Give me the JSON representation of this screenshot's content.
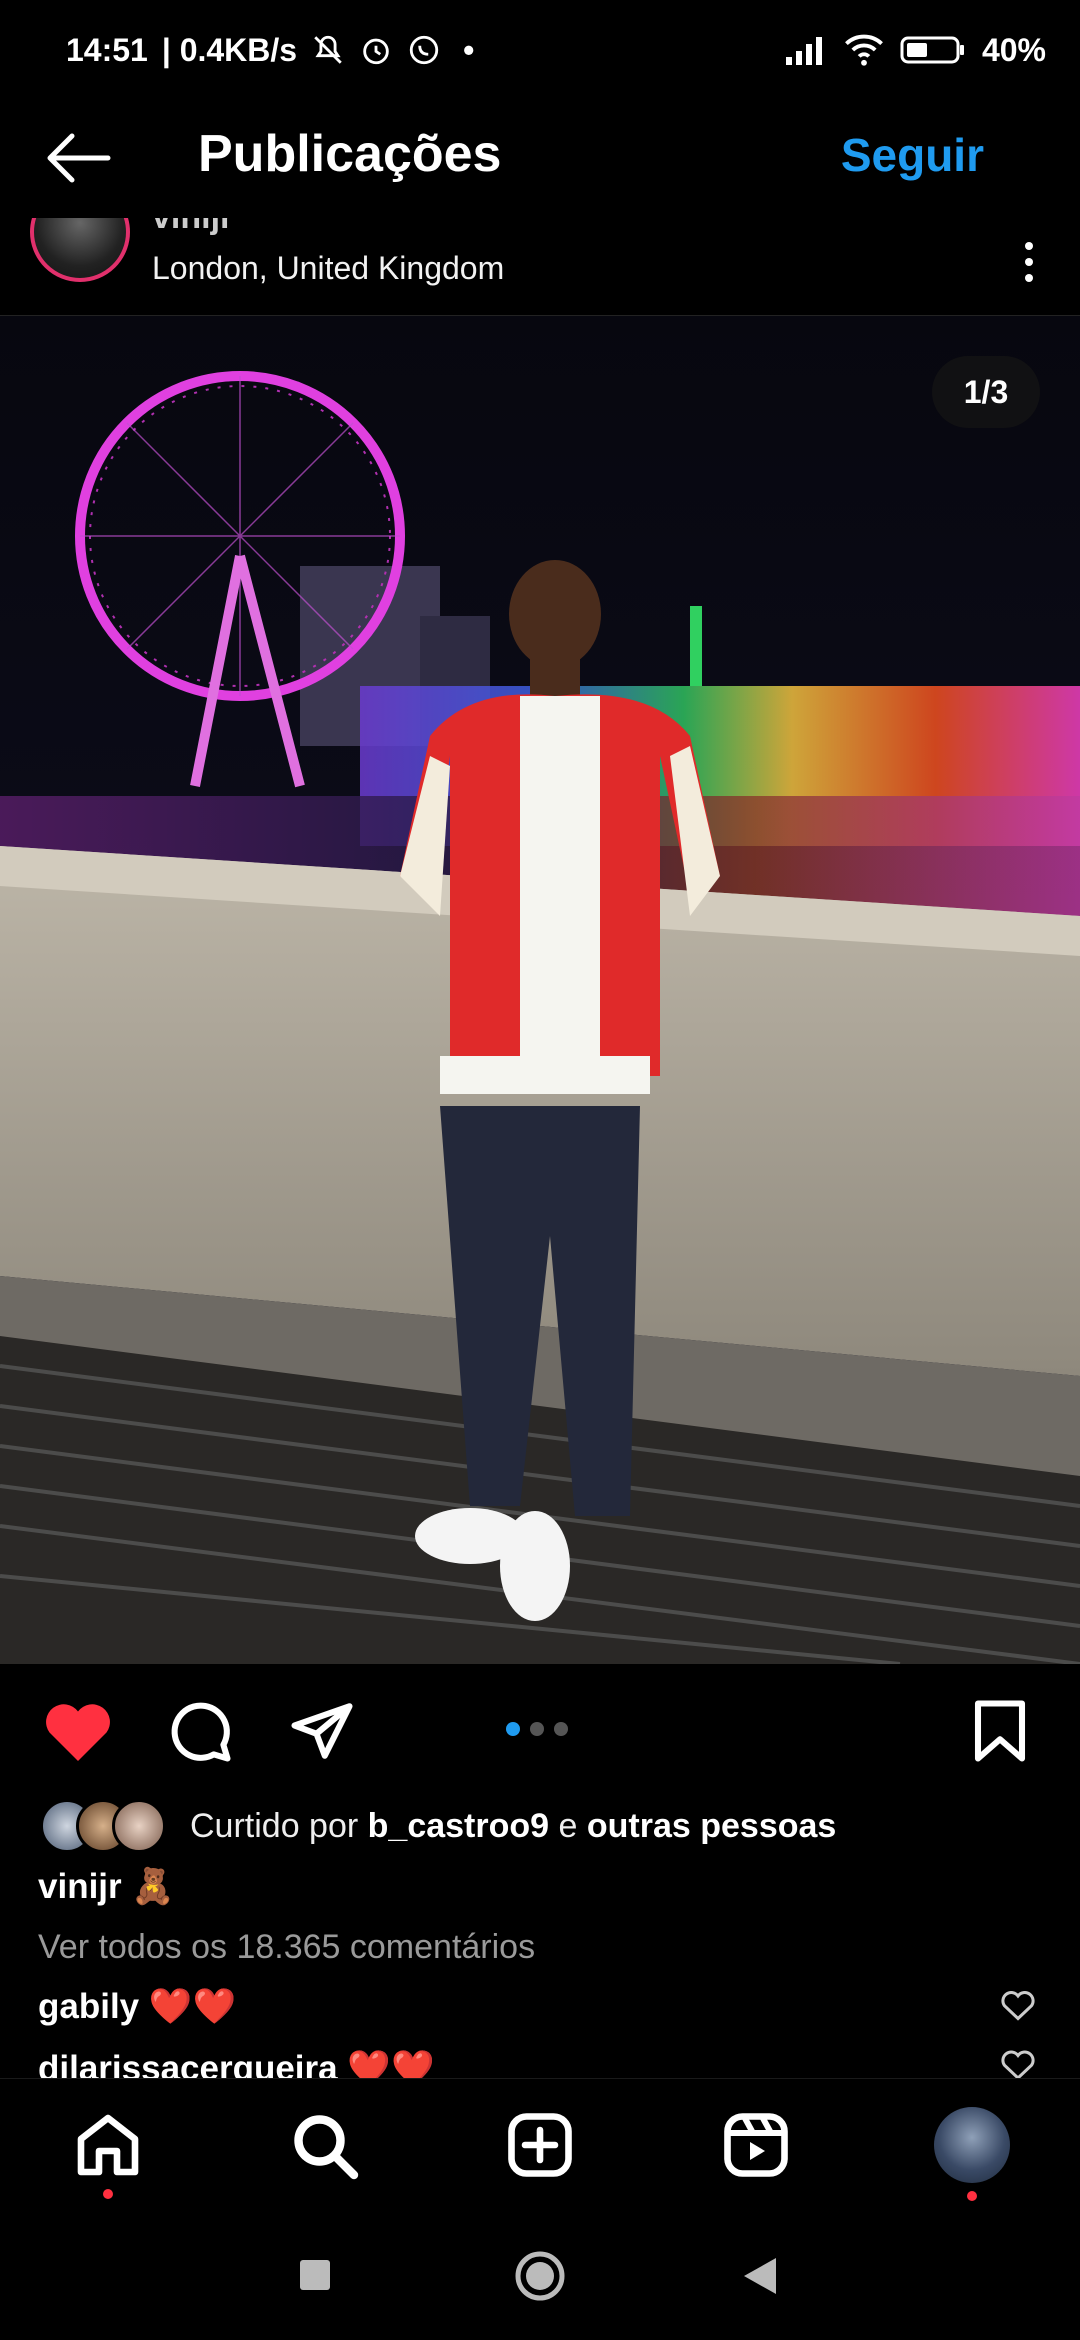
{
  "status": {
    "time": "14:51",
    "speed": "| 0.4KB/s",
    "battery": "40%",
    "dot": "•"
  },
  "appbar": {
    "title": "Publicações",
    "follow_label": "Seguir"
  },
  "post": {
    "username": "vinijr",
    "location": "London, United Kingdom",
    "counter": "1/3",
    "likes_prefix": "Curtido por",
    "likes_user": "b_castroo9",
    "likes_joiner": "e",
    "likes_suffix": "outras pessoas",
    "caption_user": "vinijr",
    "caption_text": "🧸",
    "view_all": "Ver todos os 18.365 comentários",
    "comments": [
      {
        "user": "gabily",
        "text": "❤️❤️"
      },
      {
        "user": "dilarissacerqueira",
        "text": "❤️❤️"
      }
    ]
  },
  "colors": {
    "accent": "#1f9bf0",
    "like": "#ff3040",
    "ring": "#e1306c"
  },
  "icons": [
    "back-arrow-icon",
    "more-icon",
    "heart-icon",
    "comment-icon",
    "share-icon",
    "bookmark-icon",
    "home-icon",
    "search-icon",
    "create-icon",
    "reels-icon",
    "profile-icon"
  ]
}
